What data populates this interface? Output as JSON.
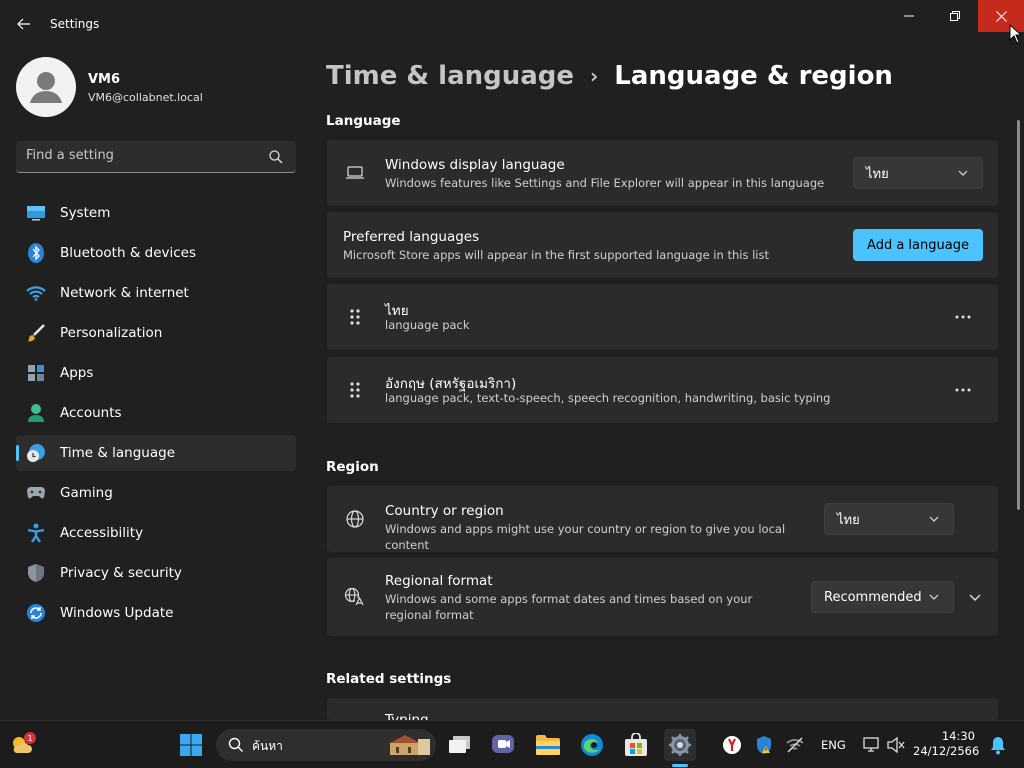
{
  "window": {
    "title": "Settings"
  },
  "user": {
    "name": "VM6",
    "email": "VM6@collabnet.local"
  },
  "search": {
    "placeholder": "Find a setting"
  },
  "sidebar": {
    "items": [
      {
        "label": "System",
        "icon": "system-icon"
      },
      {
        "label": "Bluetooth & devices",
        "icon": "bluetooth-icon"
      },
      {
        "label": "Network & internet",
        "icon": "wifi-icon"
      },
      {
        "label": "Personalization",
        "icon": "brush-icon"
      },
      {
        "label": "Apps",
        "icon": "apps-icon"
      },
      {
        "label": "Accounts",
        "icon": "accounts-icon"
      },
      {
        "label": "Time & language",
        "icon": "clock-globe-icon",
        "active": true
      },
      {
        "label": "Gaming",
        "icon": "gamepad-icon"
      },
      {
        "label": "Accessibility",
        "icon": "accessibility-icon"
      },
      {
        "label": "Privacy & security",
        "icon": "shield-icon"
      },
      {
        "label": "Windows Update",
        "icon": "update-icon"
      }
    ]
  },
  "breadcrumb": {
    "parent": "Time & language",
    "separator": "›",
    "current": "Language & region"
  },
  "language_section": {
    "heading": "Language",
    "display_language": {
      "title": "Windows display language",
      "description": "Windows features like Settings and File Explorer will appear in this language",
      "value": "ไทย"
    },
    "preferred": {
      "title": "Preferred languages",
      "description": "Microsoft Store apps will appear in the first supported language in this list",
      "button": "Add a language"
    },
    "languages": [
      {
        "name": "ไทย",
        "features": "language pack"
      },
      {
        "name": "อังกฤษ (สหรัฐอเมริกา)",
        "features": "language pack, text-to-speech, speech recognition, handwriting, basic typing"
      }
    ],
    "more_label": "···"
  },
  "region_section": {
    "heading": "Region",
    "country": {
      "title": "Country or region",
      "description": "Windows and apps might use your country or region to give you local content",
      "value": "ไทย"
    },
    "format": {
      "title": "Regional format",
      "description": "Windows and some apps format dates and times based on your regional format",
      "value": "Recommended"
    }
  },
  "related": {
    "heading": "Related settings",
    "first_item": "Typing"
  },
  "taskbar": {
    "search_text": "ค้นหา",
    "language": "ENG",
    "time": "14:30",
    "date": "24/12/2566",
    "weather_badge": "1"
  },
  "colors": {
    "accent": "#4cc2ff",
    "close": "#c42b1c",
    "background": "#202020",
    "card": "#2b2b2b"
  }
}
